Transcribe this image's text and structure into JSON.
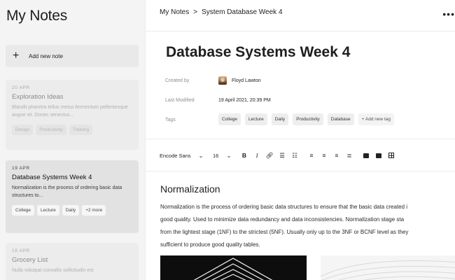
{
  "sidebar": {
    "title": "My Notes",
    "add_note_label": "Add new note",
    "notes": [
      {
        "date": "20 APR",
        "title": "Exploration Ideas",
        "excerpt": "Blandit pharetra tellus metus fermentum pellentesque augue sit. Donec senectus...",
        "tags": [
          "Design",
          "Productivity",
          "Training"
        ]
      },
      {
        "date": "19 APR",
        "title": "Database Systems Week 4",
        "excerpt": "Normalization is the process of ordering basic data structures to...",
        "tags": [
          "College",
          "Lecture",
          "Daily",
          "+2 more"
        ]
      },
      {
        "date": "18 APR",
        "title": "Grocery List",
        "excerpt": "Nulla volutpat convallis sollicitudin est",
        "tags": []
      }
    ]
  },
  "breadcrumb": {
    "root": "My Notes",
    "separator": ">",
    "current": "System Database Week 4"
  },
  "more_menu": "•••",
  "document": {
    "title": "Database Systems Week 4",
    "meta": {
      "created_by_label": "Created by",
      "created_by": "Floyd Lawton",
      "modified_label": "Last Modified",
      "modified": "19 April 2021, 20:39 PM",
      "tags_label": "Tags"
    },
    "tags": [
      "College",
      "Lecture",
      "Daily",
      "Productivity",
      "Database"
    ],
    "add_tag_label": "+ Add new tag",
    "toolbar": {
      "font": "Encode Sans",
      "size": "16",
      "dropdown_glyph": "⌄",
      "icons": [
        "bold-icon",
        "italic-icon",
        "link-icon",
        "bullet-list-icon",
        "numbered-list-icon",
        "align-left-icon",
        "align-center-icon",
        "align-right-icon",
        "justify-icon",
        "image-icon",
        "video-icon",
        "table-icon"
      ]
    },
    "heading": "Normalization",
    "paragraph_lines": [
      "Normalization is the process of ordering basic data structures to ensure that the basic data created i",
      "good quality. Used to minimize data redundancy and data inconsistencies. Normalization stage sta",
      "from the lightest stage (1NF) to the strictest (5NF). Usually only up to the 3NF or BCNF level as they",
      "sufficient to produce good quality tables."
    ]
  },
  "colors": {
    "sidebar_bg": "#f4f4f4",
    "active_card": "#e2e2e2",
    "text": "#1e1e1e",
    "muted": "#8d8d8d"
  }
}
